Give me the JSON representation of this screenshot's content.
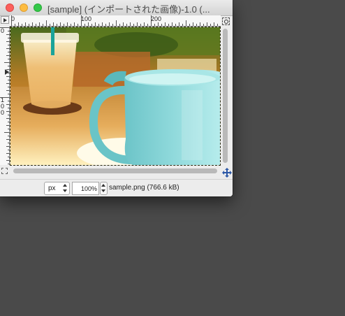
{
  "window": {
    "title": "[sample] (インポートされた画像)-1.0 (..."
  },
  "ruler": {
    "horizontal_labels": [
      "0",
      "100",
      "200"
    ],
    "vertical_labels": [
      "0",
      "1",
      "0",
      "0"
    ]
  },
  "canvas": {
    "image_name": "photo of a light-blue coffee mug and an iced latte on a café table"
  },
  "statusbar": {
    "unit": "px",
    "zoom": "100%",
    "file_info": "sample.png (766.6 kB)"
  },
  "colors": {
    "desktop": "#4a4a4a",
    "window_bg": "#ececec",
    "mug": "#7ed0d3",
    "close": "#fc605c",
    "minimize": "#fdbc40",
    "maximize": "#34c84a"
  }
}
